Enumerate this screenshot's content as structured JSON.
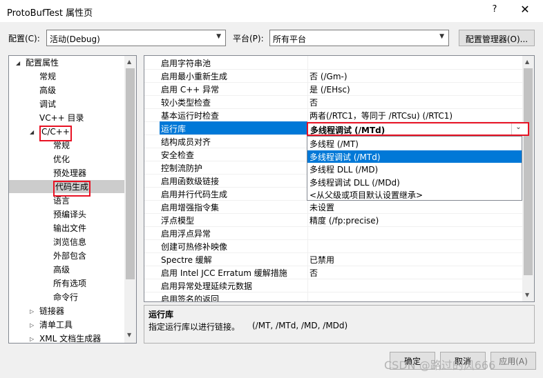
{
  "window": {
    "title": "ProtoBufTest 属性页",
    "help_label": "?",
    "close_label": "✕"
  },
  "config": {
    "config_label": "配置(C):",
    "config_value": "活动(Debug)",
    "platform_label": "平台(P):",
    "platform_value": "所有平台",
    "manager_button": "配置管理器(O)..."
  },
  "tree": {
    "items": [
      {
        "label": "配置属性",
        "exp": "◢"
      },
      {
        "label": "常规"
      },
      {
        "label": "高级"
      },
      {
        "label": "调试"
      },
      {
        "label": "VC++ 目录"
      },
      {
        "label": "C/C++",
        "exp": "◢"
      },
      {
        "label": "常规"
      },
      {
        "label": "优化"
      },
      {
        "label": "预处理器"
      },
      {
        "label": "代码生成"
      },
      {
        "label": "语言"
      },
      {
        "label": "预编译头"
      },
      {
        "label": "输出文件"
      },
      {
        "label": "浏览信息"
      },
      {
        "label": "外部包含"
      },
      {
        "label": "高级"
      },
      {
        "label": "所有选项"
      },
      {
        "label": "命令行"
      },
      {
        "label": "链接器",
        "exp": "▷"
      },
      {
        "label": "清单工具",
        "exp": "▷"
      },
      {
        "label": "XML 文档生成器",
        "exp": "▷"
      }
    ]
  },
  "grid": {
    "rows": [
      {
        "name": "启用字符串池",
        "value": ""
      },
      {
        "name": "启用最小重新生成",
        "value": "否 (/Gm-)"
      },
      {
        "name": "启用 C++ 异常",
        "value": "是 (/EHsc)"
      },
      {
        "name": "较小类型检查",
        "value": "否"
      },
      {
        "name": "基本运行时检查",
        "value": "两者(/RTC1，等同于 /RTCsu) (/RTC1)"
      },
      {
        "name": "运行库",
        "value": "多线程调试 (/MTd)"
      },
      {
        "name": "结构成员对齐",
        "value": ""
      },
      {
        "name": "安全检查",
        "value": ""
      },
      {
        "name": "控制流防护",
        "value": ""
      },
      {
        "name": "启用函数级链接",
        "value": ""
      },
      {
        "name": "启用并行代码生成",
        "value": ""
      },
      {
        "name": "启用增强指令集",
        "value": "未设置"
      },
      {
        "name": "浮点模型",
        "value": "精度 (/fp:precise)"
      },
      {
        "name": "启用浮点异常",
        "value": ""
      },
      {
        "name": "创建可热修补映像",
        "value": ""
      },
      {
        "name": "Spectre 缓解",
        "value": "已禁用"
      },
      {
        "name": "启用 Intel JCC Erratum 缓解措施",
        "value": "否"
      },
      {
        "name": "启用异常处理延续元数据",
        "value": ""
      },
      {
        "name": "启用签名的返回",
        "value": ""
      }
    ]
  },
  "dropdown": {
    "current": "多线程调试 (/MTd)",
    "options": [
      "多线程 (/MT)",
      "多线程调试 (/MTd)",
      "多线程 DLL (/MD)",
      "多线程调试 DLL (/MDd)",
      "<从父级或项目默认设置继承>"
    ]
  },
  "description": {
    "title": "运行库",
    "text": "指定运行库以进行链接。",
    "flags": "(/MT, /MTd, /MD, /MDd)"
  },
  "footer": {
    "ok_label": "确定",
    "cancel_label": "取消",
    "apply_label": "应用(A)"
  },
  "watermark": "CSDN @路过的风666",
  "colors": {
    "selection": "#0078d7",
    "highlight_border": "#e81123",
    "tree_selection": "#cccccc"
  }
}
